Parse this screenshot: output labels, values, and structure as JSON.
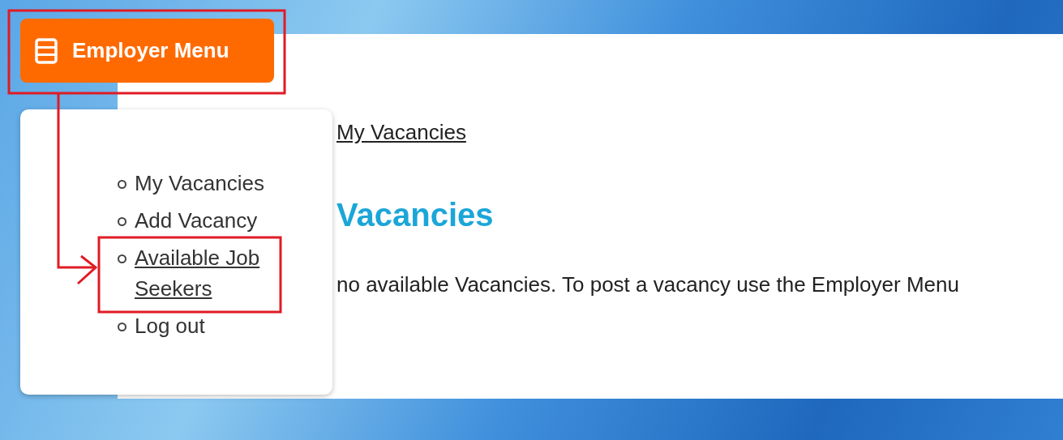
{
  "menu_button": {
    "label": "Employer Menu"
  },
  "menu_items": [
    {
      "label": "My Vacancies",
      "selected": false
    },
    {
      "label": "Add Vacancy",
      "selected": false
    },
    {
      "label": "Available Job Seekers",
      "selected": true
    },
    {
      "label": "Log out",
      "selected": false
    }
  ],
  "breadcrumb": [
    "My Vacancies"
  ],
  "heading": "Vacancies",
  "message": "no available Vacancies. To post a vacancy use the Employer Menu"
}
